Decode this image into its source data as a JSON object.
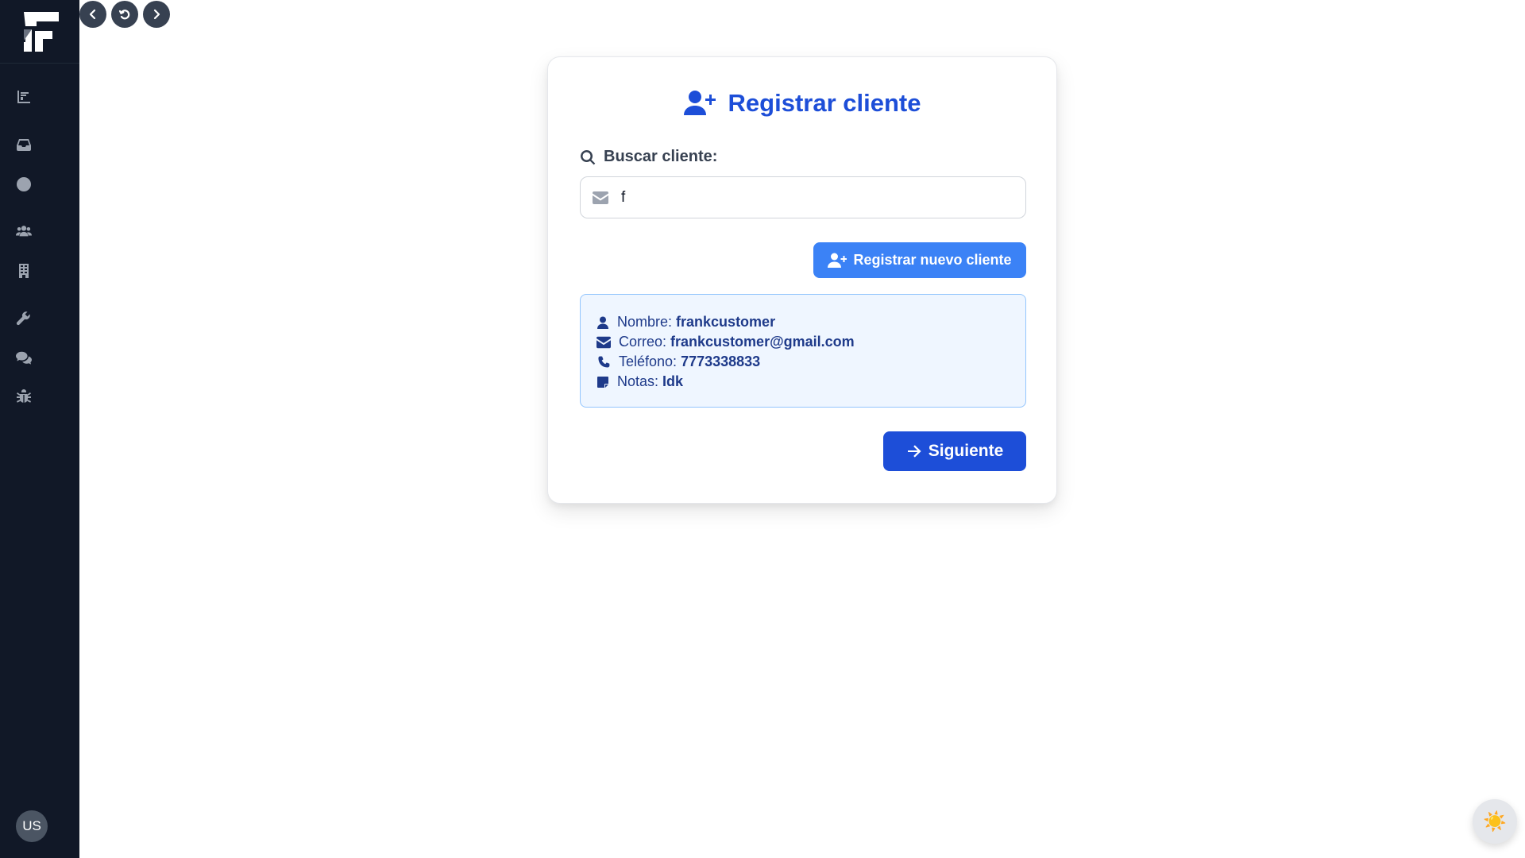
{
  "sidebar": {
    "logo": "F-logo",
    "items": [
      {
        "name": "chart-icon"
      },
      {
        "name": "inbox-icon"
      },
      {
        "name": "clock-icon"
      },
      {
        "name": "users-icon"
      },
      {
        "name": "building-icon"
      },
      {
        "name": "wrench-icon"
      },
      {
        "name": "comments-icon"
      },
      {
        "name": "bug-icon"
      }
    ],
    "avatar_initials": "US"
  },
  "topnav": {
    "back": "chevron-left-icon",
    "reload": "reload-icon",
    "forward": "chevron-right-icon"
  },
  "card": {
    "title": "Registrar cliente",
    "search_label": "Buscar cliente:",
    "search_value": "f",
    "register_button": "Registrar nuevo cliente",
    "info": {
      "nombre_label": "Nombre:",
      "nombre_value": "frankcustomer",
      "correo_label": "Correo:",
      "correo_value": "frankcustomer@gmail.com",
      "telefono_label": "Teléfono:",
      "telefono_value": "7773338833",
      "notas_label": "Notas:",
      "notas_value": "Idk"
    },
    "next_button": "Siguiente"
  },
  "theme_toggle": {
    "icon": "☀️"
  },
  "colors": {
    "sidebar_bg": "#111827",
    "primary": "#1d4ed8",
    "primary_light": "#3b82f6",
    "info_bg": "#eff6ff",
    "info_border": "#93c5fd"
  }
}
